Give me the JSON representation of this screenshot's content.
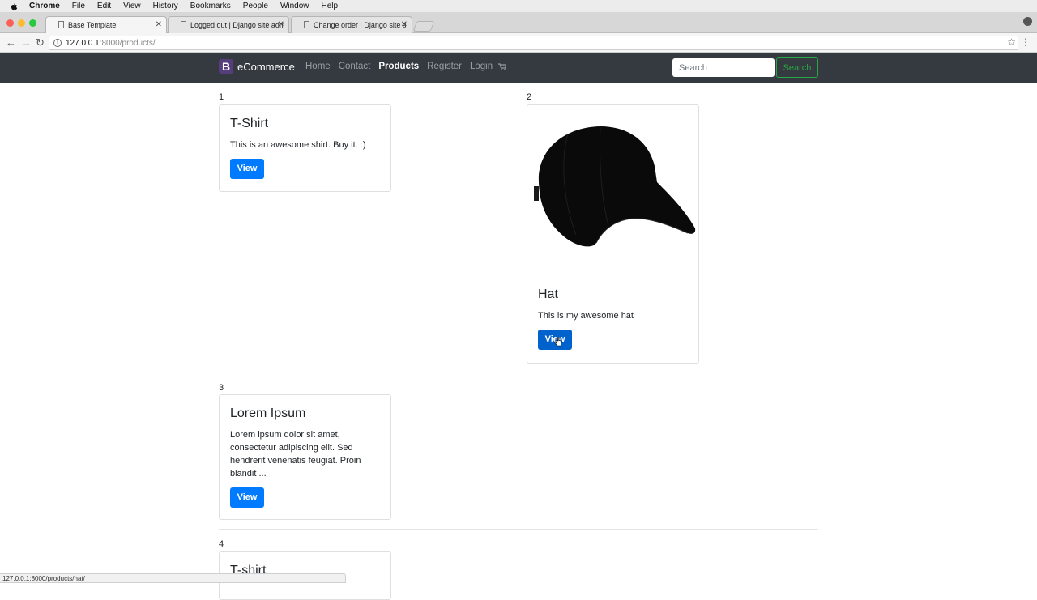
{
  "mac_menu": {
    "app": "Chrome",
    "items": [
      "File",
      "Edit",
      "View",
      "History",
      "Bookmarks",
      "People",
      "Window",
      "Help"
    ]
  },
  "tabs": [
    {
      "title": "Base Template"
    },
    {
      "title": "Logged out | Django site adm"
    },
    {
      "title": "Change order | Django site ad"
    }
  ],
  "address": {
    "host": "127.0.0.1",
    "path": ":8000/products/"
  },
  "navbar": {
    "brand_logo": "B",
    "brand": "eCommerce",
    "links": [
      "Home",
      "Contact",
      "Products",
      "Register",
      "Login"
    ],
    "active_link": "Products",
    "search_placeholder": "Search",
    "search_button": "Search"
  },
  "products": [
    {
      "num": "1",
      "title": "T-Shirt",
      "desc": "This is an awesome shirt. Buy it. :)",
      "button": "View"
    },
    {
      "num": "2",
      "title": "Hat",
      "desc": "This is my awesome hat",
      "button": "View",
      "image": "black-cap"
    },
    {
      "num": "3",
      "title": "Lorem Ipsum",
      "desc": "Lorem ipsum dolor sit amet, consectetur adipiscing elit. Sed hendrerit venenatis feugiat. Proin blandit ...",
      "button": "View"
    },
    {
      "num": "4",
      "title": "T-shirt"
    }
  ],
  "status_url": "127.0.0.1:8000/products/hat/",
  "colors": {
    "navbar": "#343a40",
    "primary": "#007bff",
    "success": "#28a745",
    "brand_logo": "#563d7c"
  }
}
